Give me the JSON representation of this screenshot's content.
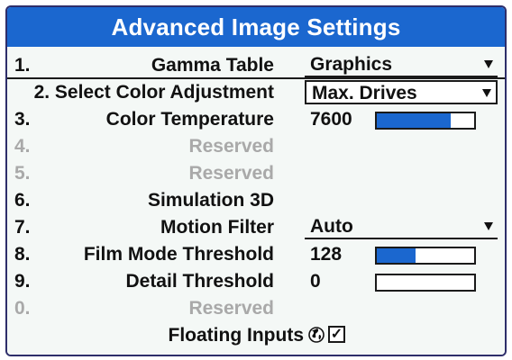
{
  "title": "Advanced Image Settings",
  "rows": [
    {
      "num": "1.",
      "label": "Gamma Table",
      "control": "dropdown",
      "value": "Graphics",
      "disabled": false
    },
    {
      "num": "2.",
      "label": "2. Select Color Adjustment",
      "control": "dropdown",
      "value": "Max. Drives",
      "disabled": false
    },
    {
      "num": "3.",
      "label": "Color Temperature",
      "control": "slider",
      "value": "7600",
      "level": 0.76,
      "disabled": false
    },
    {
      "num": "4.",
      "label": "Reserved",
      "disabled": true
    },
    {
      "num": "5.",
      "label": "Reserved",
      "disabled": true
    },
    {
      "num": "6.",
      "label": "Simulation 3D",
      "disabled": false
    },
    {
      "num": "7.",
      "label": "Motion Filter",
      "control": "dropdown",
      "value": "Auto",
      "disabled": false
    },
    {
      "num": "8.",
      "label": "Film Mode Threshold",
      "control": "slider",
      "value": "128",
      "level": 0.4,
      "disabled": false
    },
    {
      "num": "9.",
      "label": "Detail Threshold",
      "control": "slider",
      "value": "0",
      "level": 0.0,
      "disabled": false
    },
    {
      "num": "0.",
      "label": "Reserved",
      "disabled": true
    }
  ],
  "floating_inputs": {
    "label": "Floating Inputs",
    "checked": true,
    "check_mark": "✓",
    "icon": "globe-icon"
  },
  "colors": {
    "accent": "#1b67cf",
    "text": "#111111",
    "disabled": "#a9a9a9",
    "background": "#f4f8f6"
  }
}
